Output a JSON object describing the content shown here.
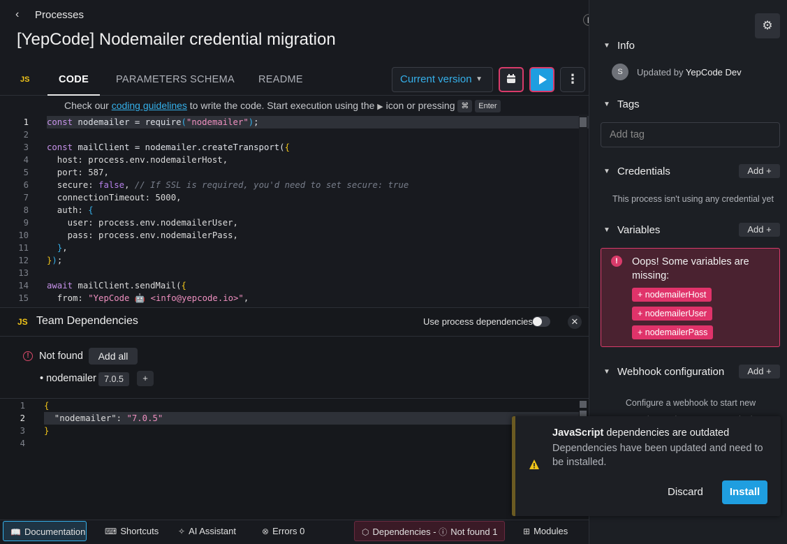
{
  "header": {
    "back_label": "Processes",
    "title": "[YepCode] Nodemailer credential migration"
  },
  "tabs": {
    "lang_badge": "JS",
    "code": "CODE",
    "params": "PARAMETERS SCHEMA",
    "readme": "README"
  },
  "toolbar": {
    "version": "Current version"
  },
  "hint": {
    "prefix": "Check our",
    "link": "coding guidelines",
    "middle": "to write the code. Start execution using the",
    "suffix": "icon or pressing",
    "key1": "⌘",
    "key2": "Enter"
  },
  "code_lines": [
    {
      "n": "1"
    },
    {
      "n": "2"
    },
    {
      "n": "3"
    },
    {
      "n": "4"
    },
    {
      "n": "5"
    },
    {
      "n": "6"
    },
    {
      "n": "7"
    },
    {
      "n": "8"
    },
    {
      "n": "9"
    },
    {
      "n": "10"
    },
    {
      "n": "11"
    },
    {
      "n": "12"
    },
    {
      "n": "13"
    },
    {
      "n": "14"
    },
    {
      "n": "15"
    }
  ],
  "code_text": {
    "l1a": "const",
    "l1b": " nodemailer = ",
    "l1c": "require",
    "l1d": "(",
    "l1e": "\"nodemailer\"",
    "l1f": ")",
    "l1g": ";",
    "l3a": "const",
    "l3b": " mailClient = nodemailer.createTransport(",
    "l3c": "{",
    "l4": "  host: process.env.nodemailerHost,",
    "l5a": "  port: ",
    "l5b": "587",
    "l5c": ",",
    "l6a": "  secure: ",
    "l6b": "false",
    "l6c": ", ",
    "l6d": "// If SSL is required, you'd need to set secure: true",
    "l7a": "  connectionTimeout: ",
    "l7b": "5000",
    "l7c": ",",
    "l8a": "  auth: ",
    "l8b": "{",
    "l9": "    user: process.env.nodemailerUser,",
    "l10": "    pass: process.env.nodemailerPass,",
    "l11a": "  ",
    "l11b": "}",
    "l11c": ",",
    "l12a": "}",
    "l12b": ")",
    "l12c": ";",
    "l14a": "await",
    "l14b": " mailClient.sendMail(",
    "l14c": "{",
    "l15a": "  from: ",
    "l15b": "\"YepCode 🤖 <info@yepcode.io>\"",
    "l15c": ","
  },
  "deps": {
    "lang_badge": "JS",
    "title": "Team Dependencies",
    "toggle_label": "Use process dependencies",
    "not_found": "Not found",
    "add_all": "Add all",
    "dep_name": "• nodemailer",
    "dep_version": "7.0.5",
    "plus": "+",
    "json_lines": [
      "1",
      "2",
      "3",
      "4"
    ],
    "json_open": "{",
    "json_key": "  \"nodemailer\"",
    "json_colon": ": ",
    "json_val": "\"7.0.5\"",
    "json_close": "}"
  },
  "toast": {
    "title_bold": "JavaScript",
    "title_rest": " dependencies are outdated",
    "message": "Dependencies have been updated and need to be installed.",
    "discard": "Discard",
    "install": "Install"
  },
  "footer": {
    "documentation": "Documentation",
    "shortcuts": "Shortcuts",
    "ai": "AI Assistant",
    "errors": "Errors 0",
    "dependencies": "Dependencies",
    "dep_sep": "-",
    "not_found": "Not found 1",
    "modules": "Modules"
  },
  "sidebar": {
    "info": "Info",
    "avatar": "S",
    "updated_by": "Updated by",
    "updater": "YepCode Dev",
    "tags": "Tags",
    "tag_placeholder": "Add tag",
    "credentials": "Credentials",
    "add": "Add +",
    "cred_msg": "This process isn't using any credential yet",
    "variables": "Variables",
    "var_error": "Oops! Some variables are missing:",
    "missing_vars": [
      "+ nodemailerHost",
      "+ nodemailerUser",
      "+ nodemailerPass"
    ],
    "webhook": "Webhook configuration",
    "webhook_msg": "Configure a webhook to start new executions using an HTTP endpoint"
  },
  "colors": {
    "accent": "#1f9ee0",
    "danger": "#d93b6a",
    "js_badge": "#f0c419"
  }
}
